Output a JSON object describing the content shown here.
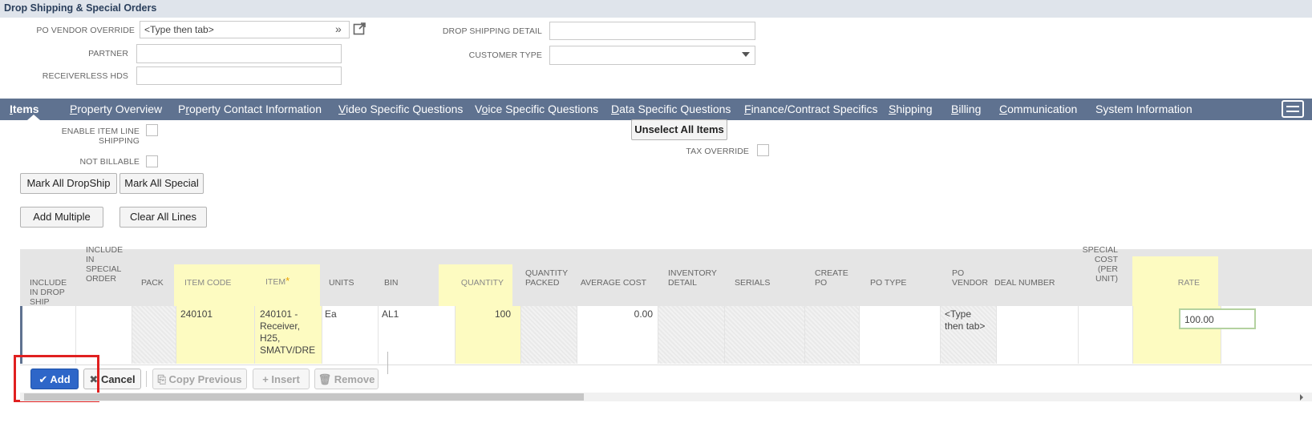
{
  "section": {
    "title": "Drop Shipping & Special Orders"
  },
  "fields": {
    "po_vendor_override": {
      "label": "PO VENDOR OVERRIDE",
      "value": "<Type then tab>"
    },
    "partner": {
      "label": "PARTNER",
      "value": ""
    },
    "receiverless_hds": {
      "label": "RECEIVERLESS HDS",
      "value": ""
    },
    "drop_shipping_detail": {
      "label": "DROP SHIPPING DETAIL",
      "value": ""
    },
    "customer_type": {
      "label": "CUSTOMER TYPE",
      "value": ""
    }
  },
  "tabs": [
    {
      "pre": "",
      "key": "I",
      "post": "tems",
      "active": true
    },
    {
      "pre": "",
      "key": "P",
      "post": "roperty Overview"
    },
    {
      "pre": "P",
      "key": "r",
      "post": "operty Contact Information"
    },
    {
      "pre": "",
      "key": "V",
      "post": "ideo Specific Questions"
    },
    {
      "pre": "V",
      "key": "o",
      "post": "ice Specific Questions"
    },
    {
      "pre": "",
      "key": "D",
      "post": "ata Specific Questions"
    },
    {
      "pre": "",
      "key": "F",
      "post": "inance/Contract Specifics"
    },
    {
      "pre": "",
      "key": "S",
      "post": "hipping"
    },
    {
      "pre": "",
      "key": "B",
      "post": "illing"
    },
    {
      "pre": "",
      "key": "C",
      "post": "ommunication"
    },
    {
      "pre": "System Information",
      "key": "",
      "post": ""
    }
  ],
  "items_tab": {
    "enable_item_line_shipping_l1": "ENABLE ITEM LINE",
    "enable_item_line_shipping_l2": "SHIPPING",
    "not_billable": "NOT BILLABLE",
    "tax_override": "TAX OVERRIDE",
    "unselect_all_items": "Unselect All Items",
    "mark_all_dropship": "Mark All DropShip",
    "mark_all_special": "Mark All Special",
    "add_multiple": "Add Multiple",
    "clear_all_lines": "Clear All Lines"
  },
  "grid": {
    "headers": {
      "include_drop_ship": [
        "INCLUDE",
        "IN DROP",
        "SHIP"
      ],
      "include_special_order": [
        "INCLUDE",
        "IN",
        "SPECIAL",
        "ORDER"
      ],
      "pack": "PACK",
      "item_code": "ITEM CODE",
      "item": "ITEM",
      "item_required": "*",
      "units": "UNITS",
      "bin": "BIN",
      "quantity": "QUANTITY",
      "quantity_packed": [
        "QUANTITY",
        "PACKED"
      ],
      "average_cost": "AVERAGE COST",
      "inventory_detail": [
        "INVENTORY",
        "DETAIL"
      ],
      "serials": "SERIALS",
      "create_po": [
        "CREATE",
        "PO"
      ],
      "po_type": "PO TYPE",
      "po_vendor": [
        "PO",
        "VENDOR"
      ],
      "deal_number": "DEAL NUMBER",
      "special_cost": [
        "SPECIAL",
        "COST",
        "(PER",
        "UNIT)"
      ],
      "rate": "RATE"
    },
    "row": {
      "item_code": "240101",
      "item": [
        "240101 -",
        "Receiver,",
        "H25,",
        "SMATV/DRE"
      ],
      "units": "Ea",
      "bin": "AL1",
      "quantity": "100",
      "average_cost": "0.00",
      "po_vendor": [
        "<Type",
        "then tab>"
      ],
      "rate": "100.00"
    }
  },
  "actions": {
    "add": "Add",
    "cancel": "Cancel",
    "copy_previous": "Copy Previous",
    "insert": "Insert",
    "remove": "Remove"
  },
  "colors": {
    "tabbar": "#5f7290",
    "highlight": "#fdfbc1",
    "add_button": "#2e66c8",
    "annotation": "#e02020"
  }
}
